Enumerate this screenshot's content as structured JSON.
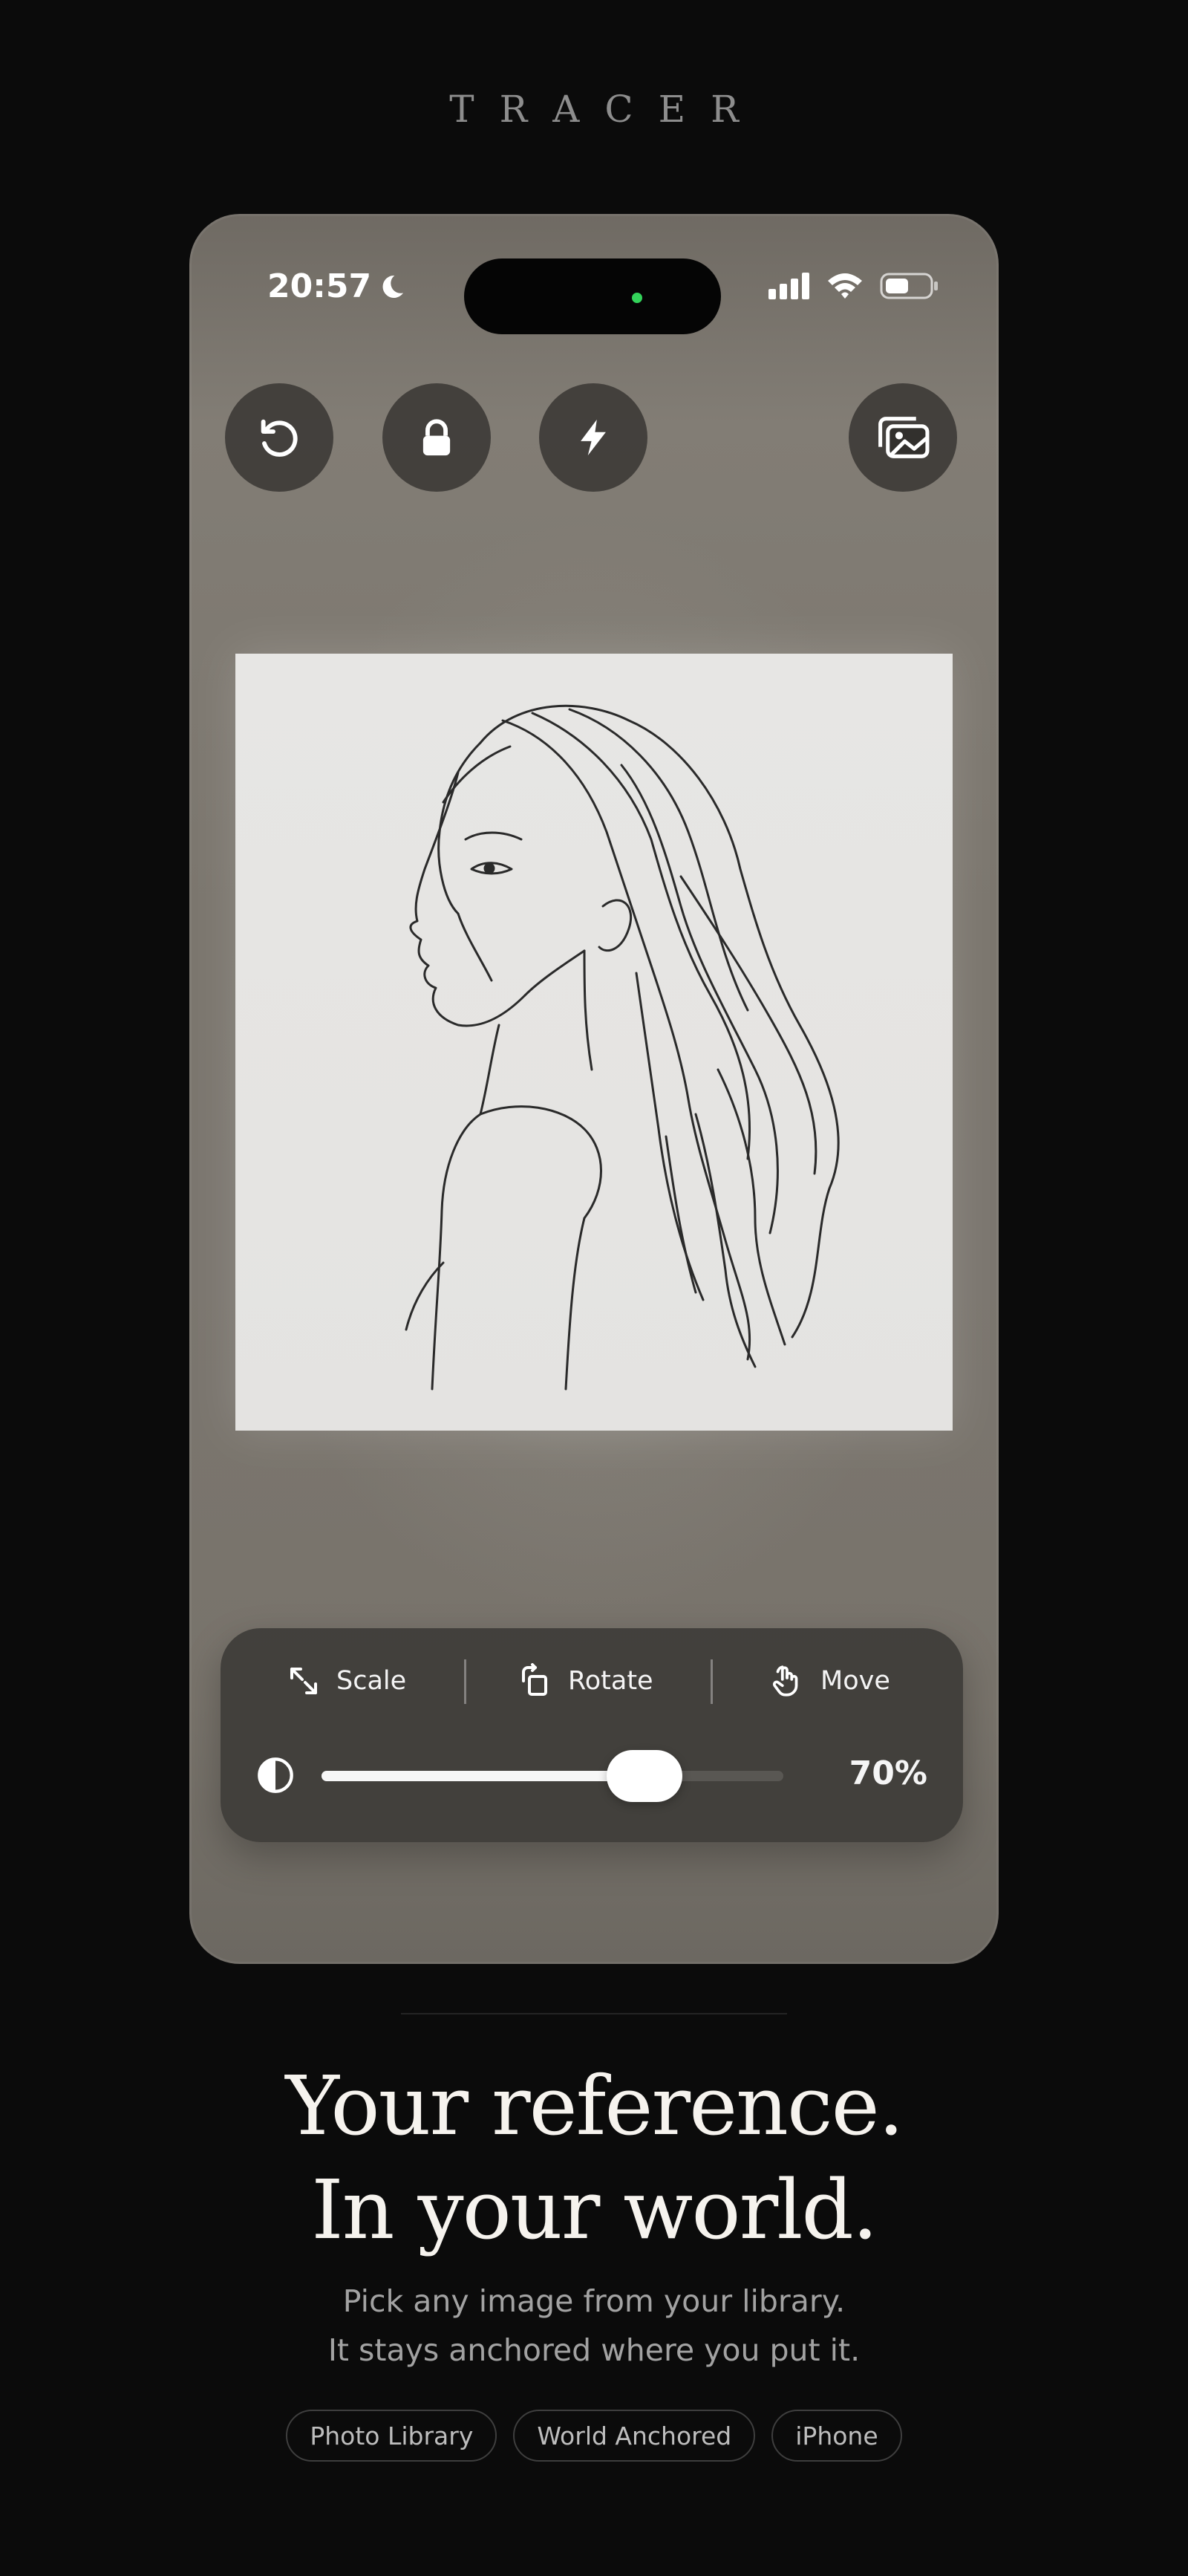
{
  "brand": {
    "name": "TRACER"
  },
  "status_bar": {
    "time": "20:57"
  },
  "toolbar": {
    "icons": [
      "reset-icon",
      "lock-icon",
      "flash-icon",
      "gallery-icon"
    ]
  },
  "controls": {
    "tools": [
      {
        "label": "Scale",
        "icon": "scale-icon"
      },
      {
        "label": "Rotate",
        "icon": "rotate-icon"
      },
      {
        "label": "Move",
        "icon": "move-hand-icon"
      }
    ],
    "opacity": {
      "value": 0.7,
      "label": "70%"
    }
  },
  "hero": {
    "line1": "Your reference.",
    "line2": "In your world.",
    "sub1": "Pick any image from your library.",
    "sub2": "It stays anchored where you put it."
  },
  "chips": [
    "Photo Library",
    "World Anchored",
    "iPhone"
  ],
  "colors": {
    "background": "#0b0b0b",
    "live_dot": "#33d35a"
  }
}
